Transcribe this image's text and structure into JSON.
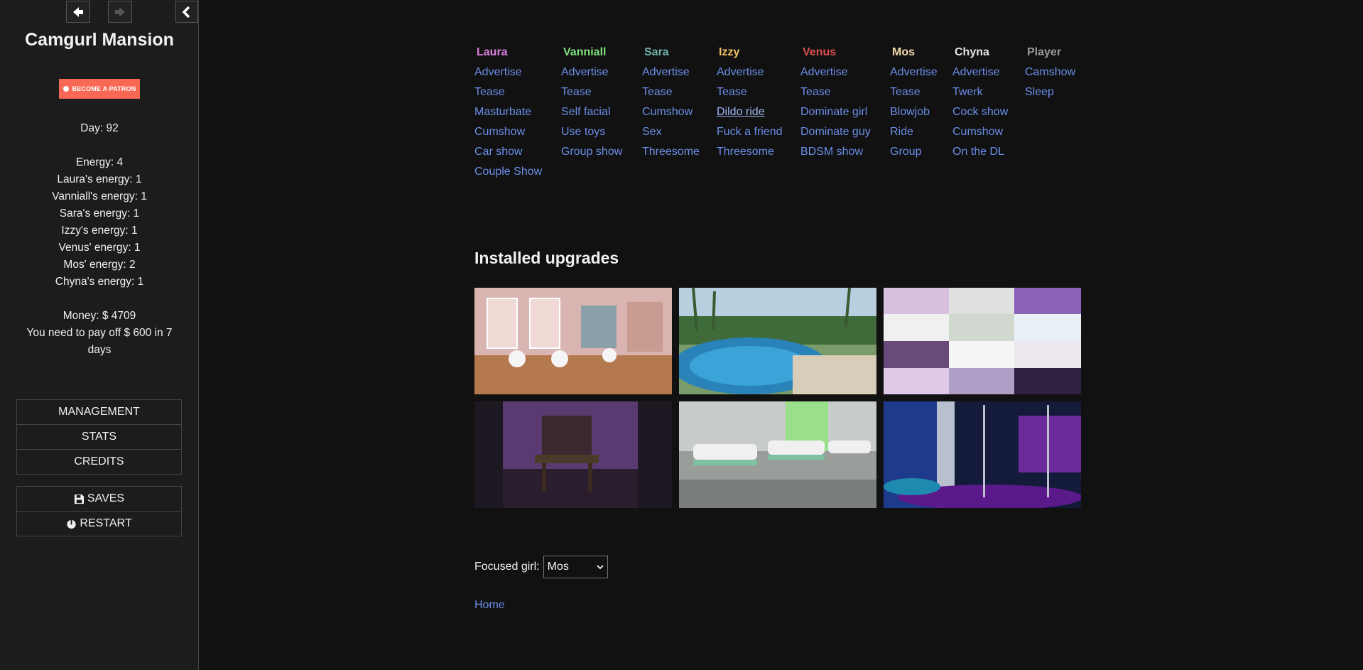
{
  "sidebar": {
    "title": "Camgurl Mansion",
    "patron_label": "BECOME A PATRON",
    "stats_day": "Day: 92",
    "stats_energy": [
      "Energy: 4",
      "Laura's energy: 1",
      "Vanniall's energy: 1",
      "Sara's energy: 1",
      "Izzy's energy: 1",
      "Venus' energy: 1",
      "Mos' energy: 2",
      "Chyna's energy: 1"
    ],
    "money": "Money: $ 4709",
    "debt": "You need to pay off $ 600 in 7 days",
    "menu_main": [
      "MANAGEMENT",
      "STATS",
      "CREDITS"
    ],
    "menu_sys": [
      "SAVES",
      "RESTART"
    ]
  },
  "columns": [
    {
      "name": "Laura",
      "color": "#e07fe0",
      "actions": [
        "Advertise",
        "Tease",
        "Masturbate",
        "Cumshow",
        "Car show",
        "Couple Show"
      ]
    },
    {
      "name": "Vanniall",
      "color": "#7ee07e",
      "actions": [
        "Advertise",
        "Tease",
        "Self facial",
        "Use toys",
        "Group show"
      ]
    },
    {
      "name": "Sara",
      "color": "#6fb3a8",
      "actions": [
        "Advertise",
        "Tease",
        "Cumshow",
        "Sex",
        "Threesome"
      ]
    },
    {
      "name": "Izzy",
      "color": "#f0c060",
      "actions": [
        "Advertise",
        "Tease",
        "Dildo ride",
        "Fuck a friend",
        "Threesome"
      ]
    },
    {
      "name": "Venus",
      "color": "#e05050",
      "actions": [
        "Advertise",
        "Tease",
        "Dominate girl",
        "Dominate guy",
        "BDSM show"
      ]
    },
    {
      "name": "Mos",
      "color": "#f5ddb0",
      "actions": [
        "Advertise",
        "Tease",
        "Blowjob",
        "Ride",
        "Group"
      ]
    },
    {
      "name": "Chyna",
      "color": "#e6e6e6",
      "actions": [
        "Advertise",
        "Twerk",
        "Cock show",
        "Cumshow",
        "On the DL"
      ]
    },
    {
      "name": "Player",
      "color": "#999999",
      "actions": [
        "Camshow",
        "Sleep"
      ]
    }
  ],
  "upgrades_title": "Installed upgrades",
  "upgrade_images": [
    "makeup-room",
    "pool-jacuzzi",
    "bedroom-collage",
    "dungeon-room",
    "hospital-room",
    "pole-dance-club"
  ],
  "focus_label": "Focused girl:",
  "focus_value": "Mos",
  "home_label": "Home"
}
